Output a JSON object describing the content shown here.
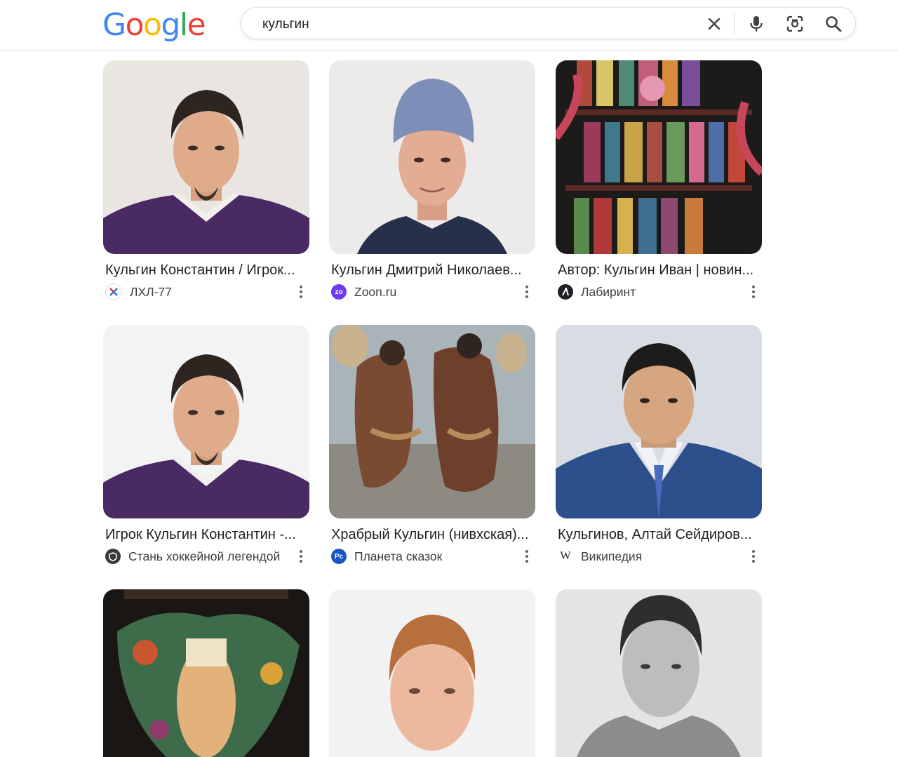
{
  "header": {
    "logo_letters": [
      {
        "ch": "G",
        "color": "#4285F4"
      },
      {
        "ch": "o",
        "color": "#EA4335"
      },
      {
        "ch": "o",
        "color": "#FBBC05"
      },
      {
        "ch": "g",
        "color": "#4285F4"
      },
      {
        "ch": "l",
        "color": "#34A853"
      },
      {
        "ch": "e",
        "color": "#EA4335"
      }
    ],
    "search_value": "кульгин",
    "icons": [
      "close-icon",
      "microphone-icon",
      "lens-icon",
      "search-icon"
    ]
  },
  "results": [
    {
      "caption": "Кульгин Константин / Игрок...",
      "source": "ЛХЛ-77",
      "favicon": "lhl77"
    },
    {
      "caption": "Кульгин Дмитрий Николаев...",
      "source": "Zoon.ru",
      "favicon": "zoon"
    },
    {
      "caption": "Автор: Кульгин Иван | новин...",
      "source": "Лабиринт",
      "favicon": "labirint"
    },
    {
      "caption": "Игрок Кульгин Константин -...",
      "source": "Стань хоккейной легендой",
      "favicon": "shield"
    },
    {
      "caption": "Храбрый Кульгин (нивхская)...",
      "source": "Планета сказок",
      "favicon": "planeta"
    },
    {
      "caption": "Кульгинов, Алтай Сейдиров...",
      "source": "Википедия",
      "favicon": "wikipedia"
    },
    {
      "caption": "",
      "source": "",
      "favicon": ""
    },
    {
      "caption": "",
      "source": "",
      "favicon": ""
    },
    {
      "caption": "",
      "source": "",
      "favicon": ""
    }
  ],
  "colors": {
    "brand_blue": "#4285F4",
    "text": "#202124",
    "secondary": "#3c4043",
    "zoon": "#6c3cf0",
    "labirint": "#202124",
    "planeta": "#1a56c4"
  }
}
